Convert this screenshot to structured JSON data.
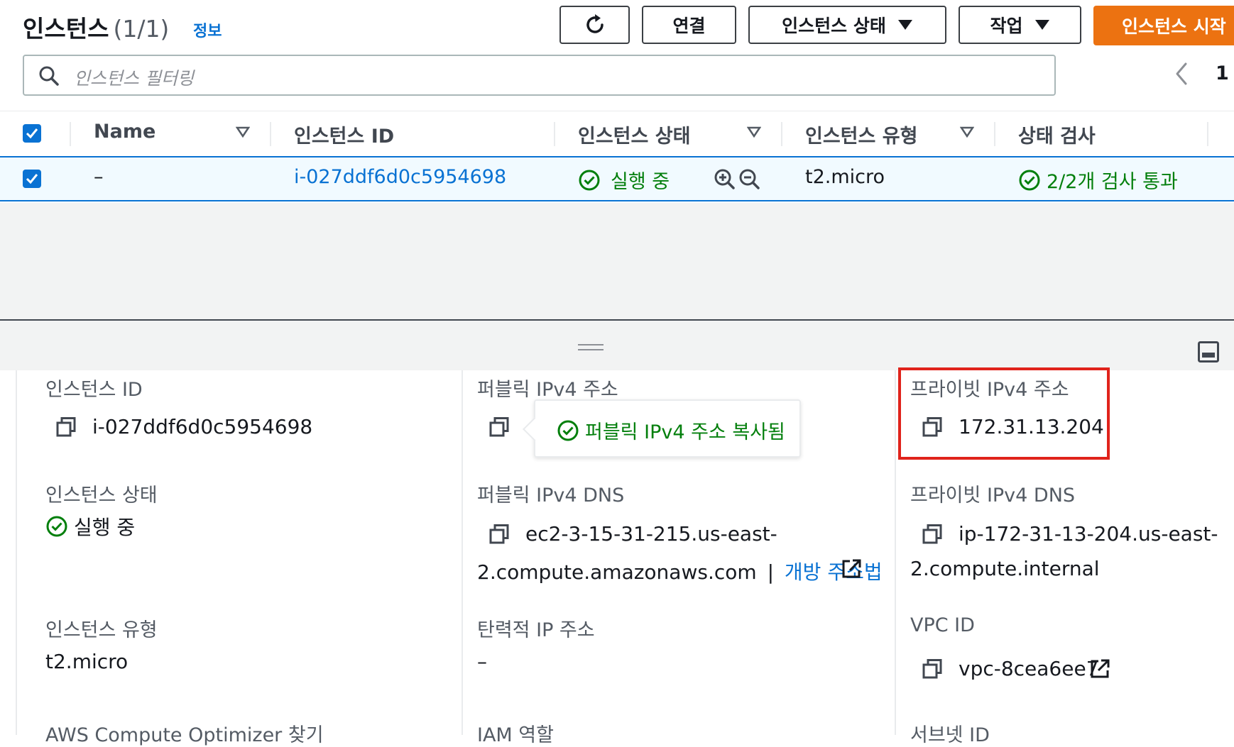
{
  "header": {
    "title": "인스턴스",
    "count": "(1/1)",
    "info_link": "정보",
    "buttons": {
      "connect": "연결",
      "instance_state": "인스턴스 상태",
      "actions": "작업",
      "launch": "인스턴스 시작"
    }
  },
  "search": {
    "placeholder": "인스턴스 필터링"
  },
  "pagination": {
    "page": "1"
  },
  "table": {
    "columns": [
      "Name",
      "인스턴스 ID",
      "인스턴스 상태",
      "인스턴스 유형",
      "상태 검사"
    ],
    "rows": [
      {
        "name": "–",
        "instance_id": "i-027ddf6d0c5954698",
        "state": "실행 중",
        "type": "t2.micro",
        "status_check": "2/2개 검사 통과"
      }
    ]
  },
  "details": {
    "col1": {
      "instance_id_label": "인스턴스 ID",
      "instance_id": "i-027ddf6d0c5954698",
      "state_label": "인스턴스 상태",
      "state": "실행 중",
      "type_label": "인스턴스 유형",
      "type": "t2.micro",
      "optimizer_label": "AWS Compute Optimizer 찾기"
    },
    "col2": {
      "public_ip_label": "퍼블릭 IPv4 주소",
      "tooltip": "퍼블릭 IPv4 주소 복사됨",
      "public_dns_label": "퍼블릭 IPv4 DNS",
      "public_dns_line1": "ec2-3-15-31-215.us-east-",
      "public_dns_line2": "2.compute.amazonaws.com",
      "separator": "|",
      "open_address": "개방 주소법",
      "elastic_ip_label": "탄력적 IP 주소",
      "elastic_ip": "–",
      "iam_label": "IAM 역할"
    },
    "col3": {
      "private_ip_label": "프라이빗 IPv4 주소",
      "private_ip": "172.31.13.204",
      "private_dns_label": "프라이빗 IPv4 DNS",
      "private_dns_line1": "ip-172-31-13-204.us-east-",
      "private_dns_line2": "2.compute.internal",
      "vpc_label": "VPC ID",
      "vpc_id": "vpc-8cea6ee7",
      "subnet_label": "서브넷 ID"
    }
  },
  "colors": {
    "link": "#0972d3",
    "success": "#037f0c",
    "primary_button": "#ec7211",
    "highlight": "#e0231b"
  },
  "icons": [
    "refresh-icon",
    "caret-down-icon",
    "search-icon",
    "chevron-left-icon",
    "check-icon",
    "sort-icon",
    "zoom-in-icon",
    "zoom-out-icon",
    "check-circle-icon",
    "copy-icon",
    "external-link-icon",
    "drag-handle-icon",
    "panel-toggle-icon"
  ]
}
